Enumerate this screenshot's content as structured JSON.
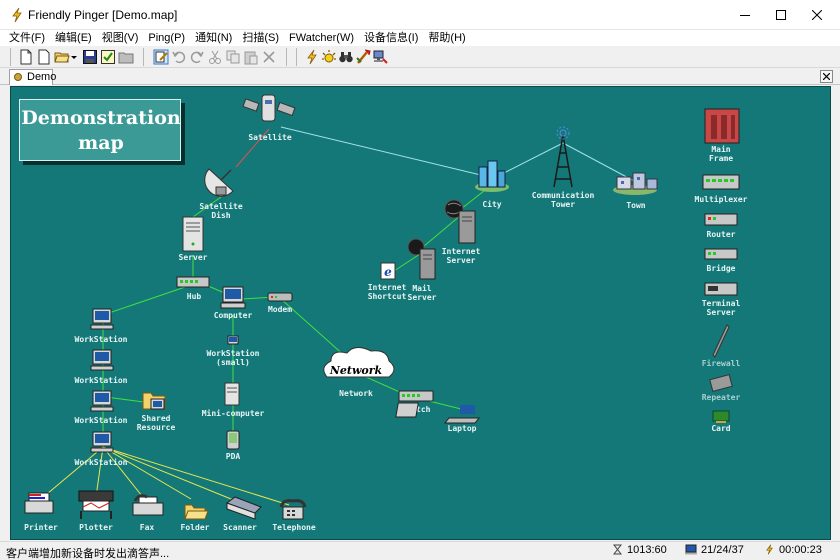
{
  "window": {
    "title": "Friendly Pinger [Demo.map]"
  },
  "menu": [
    "文件(F)",
    "编辑(E)",
    "视图(V)",
    "Ping(P)",
    "通知(N)",
    "扫描(S)",
    "FWatcher(W)",
    "设备信息(I)",
    "帮助(H)"
  ],
  "toolbar": {
    "icons": [
      "new-icon",
      "new-blank-icon",
      "open-folder-icon",
      "dropdown-arrow-icon",
      "save-icon",
      "properties-icon",
      "folder-icon",
      "edit-mode-icon",
      "undo-icon",
      "redo-icon",
      "cut-icon",
      "copy-icon",
      "paste-icon",
      "delete-icon",
      "ping-lightning-icon",
      "alarm-icon",
      "binoculars-icon",
      "traceroute-icon",
      "scan-icon"
    ]
  },
  "tabs": [
    {
      "label": "Demo",
      "active": true
    }
  ],
  "map": {
    "title_line1": "Demonstration",
    "title_line2": "map",
    "background_color": "#147878",
    "node_labels": {
      "satellite": "Satellite",
      "satellite_dish_1": "Satellite",
      "satellite_dish_2": "Dish",
      "server": "Server",
      "hub": "Hub",
      "computer": "Computer",
      "modem": "Modem",
      "workstation_1": "WorkStation",
      "workstation_2": "WorkStation",
      "workstation_3": "WorkStation",
      "workstation_4": "WorkStation",
      "workstation_small_1": "WorkStation",
      "workstation_small_2": "(small)",
      "shared_resource_1": "Shared",
      "shared_resource_2": "Resource",
      "mini_computer": "Mini-computer",
      "pda": "PDA",
      "network_cloud": "Network",
      "network": "Network",
      "switch": "Switch",
      "laptop": "Laptop",
      "city": "City",
      "comm_tower_1": "Communication",
      "comm_tower_2": "Tower",
      "town": "Town",
      "internet_server_1": "Internet",
      "internet_server_2": "Server",
      "mail_server_1": "Mail",
      "mail_server_2": "Server",
      "internet_shortcut_1": "Internet",
      "internet_shortcut_2": "Shortcut",
      "printer": "Printer",
      "plotter": "Plotter",
      "fax": "Fax",
      "folder": "Folder",
      "scanner": "Scanner",
      "telephone": "Telephone",
      "main_frame_1": "Main",
      "main_frame_2": "Frame",
      "multiplexer": "Multiplexer",
      "router": "Router",
      "bridge": "Bridge",
      "terminal_server_1": "Terminal",
      "terminal_server_2": "Server",
      "firewall": "Firewall",
      "repeater": "Repeater",
      "card": "Card"
    }
  },
  "statusbar": {
    "message": "客户端增加新设备时发出滴答声...",
    "time_counter": "1013:60",
    "hosts": "21/24/37",
    "elapsed": "00:00:23"
  }
}
